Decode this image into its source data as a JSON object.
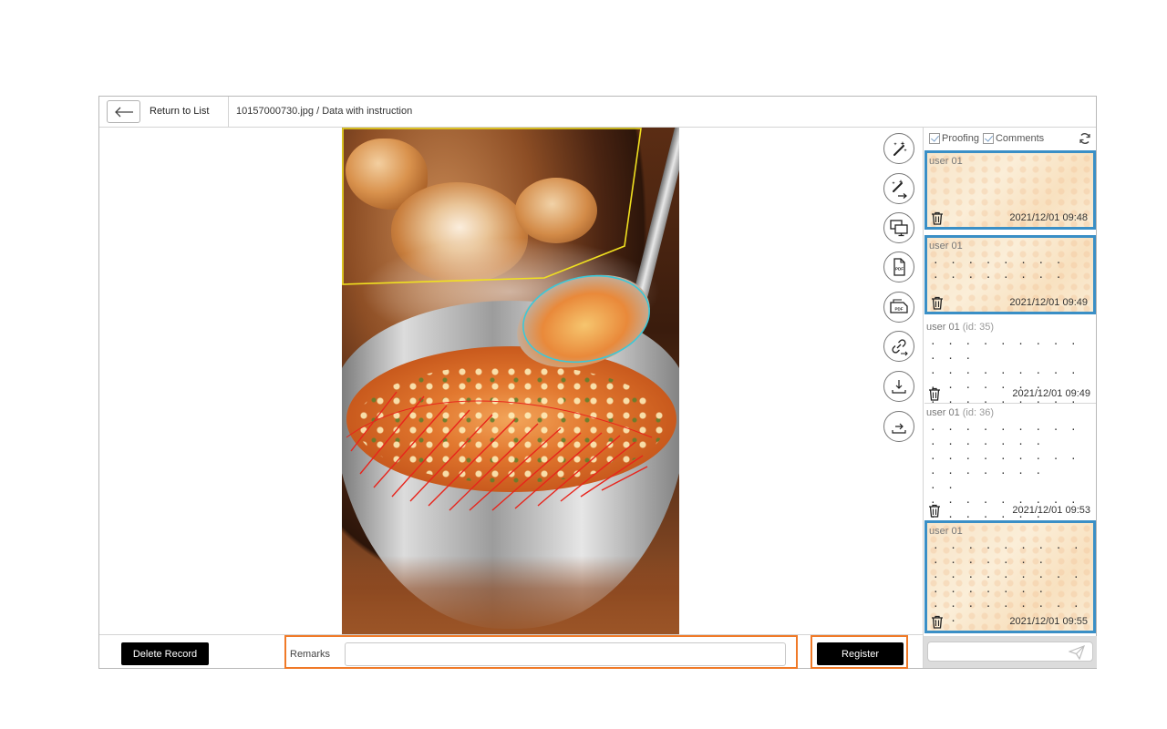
{
  "header": {
    "return_label": "Return to List",
    "file_title": "10157000730.jpg / Data with instruction"
  },
  "tools": [
    {
      "icon": "magic-wand-icon"
    },
    {
      "icon": "magic-wand-arrow-icon"
    },
    {
      "icon": "screens-icon"
    },
    {
      "icon": "pdf-portrait-icon",
      "label": "PDF"
    },
    {
      "icon": "pdf-landscape-icon",
      "label": "PDF"
    },
    {
      "icon": "link-icon"
    },
    {
      "icon": "download-icon"
    },
    {
      "icon": "export-icon"
    }
  ],
  "panel": {
    "filter_proofing": "Proofing",
    "filter_comments": "Comments",
    "entries": [
      {
        "user": "user 01",
        "id": "",
        "body": "",
        "time": "2021/12/01 09:48"
      },
      {
        "user": "user 01",
        "id": "",
        "body": "· · · · · · · ·\n· · · · · · · ·",
        "time": "2021/12/01 09:49"
      },
      {
        "user": "user 01",
        "id": "(id: 35)",
        "body": "· · · · · · · · · · · ·\n· · · · · · · · · · · · · · · ·\n· · · · · · · · · · · · ·",
        "time": "2021/12/01 09:49"
      },
      {
        "user": "user 01",
        "id": "(id: 36)",
        "body": "· · · · · · · · · · · · · · · ·\n· · · · · · · · · · · · · · · ·\n· ·\n· · · · · · · · · · · · · · · ·\n· · · ·",
        "time": "2021/12/01 09:53"
      },
      {
        "user": "user 01",
        "id": "",
        "body": "· · · · · · · · · · · · · · · ·\n· · · · · · · · · · · · · · · ·\n· · · · · · · · · · ·\n· · · · · · · · · · · · · · · ·\n· · · · · · · · · · · ·",
        "time": "2021/12/01 09:55"
      }
    ],
    "comment_placeholder": ""
  },
  "footer": {
    "delete_label": "Delete Record",
    "remarks_label": "Remarks",
    "remarks_value": "",
    "register_label": "Register"
  },
  "colors": {
    "highlight_blue": "#3a8fc6",
    "highlight_orange": "#f07a28",
    "annotation_yellow": "#f0e020",
    "annotation_cyan": "#3cc8d8",
    "annotation_red": "#e8241c"
  }
}
